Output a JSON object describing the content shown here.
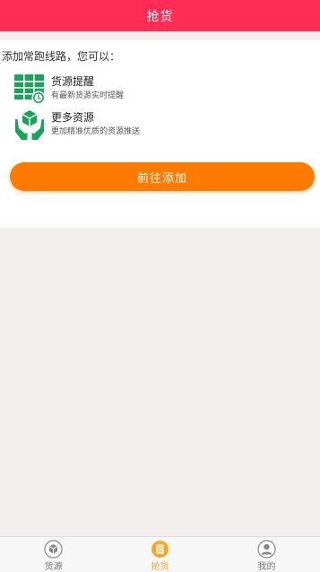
{
  "header": {
    "title": "抢货"
  },
  "card": {
    "intro": "添加常跑线路，您可以：",
    "features": [
      {
        "title": "货源提醒",
        "desc": "有最新货源实时提醒",
        "icon": "calendar-clock-icon"
      },
      {
        "title": "更多资源",
        "desc": "更加精准优质的资源推送",
        "icon": "hands-box-icon"
      }
    ],
    "button_label": "前往添加"
  },
  "tabbar": {
    "tabs": [
      {
        "label": "货源",
        "icon": "cargo-icon",
        "active": false
      },
      {
        "label": "抢货",
        "icon": "clipboard-icon",
        "active": true
      },
      {
        "label": "我的",
        "icon": "user-icon",
        "active": false
      }
    ]
  },
  "colors": {
    "header": "#ff2d55",
    "button": "#ff7a00",
    "icon_green": "#1aa35a",
    "tab_active": "#f5a623",
    "tab_inactive": "#777777"
  }
}
